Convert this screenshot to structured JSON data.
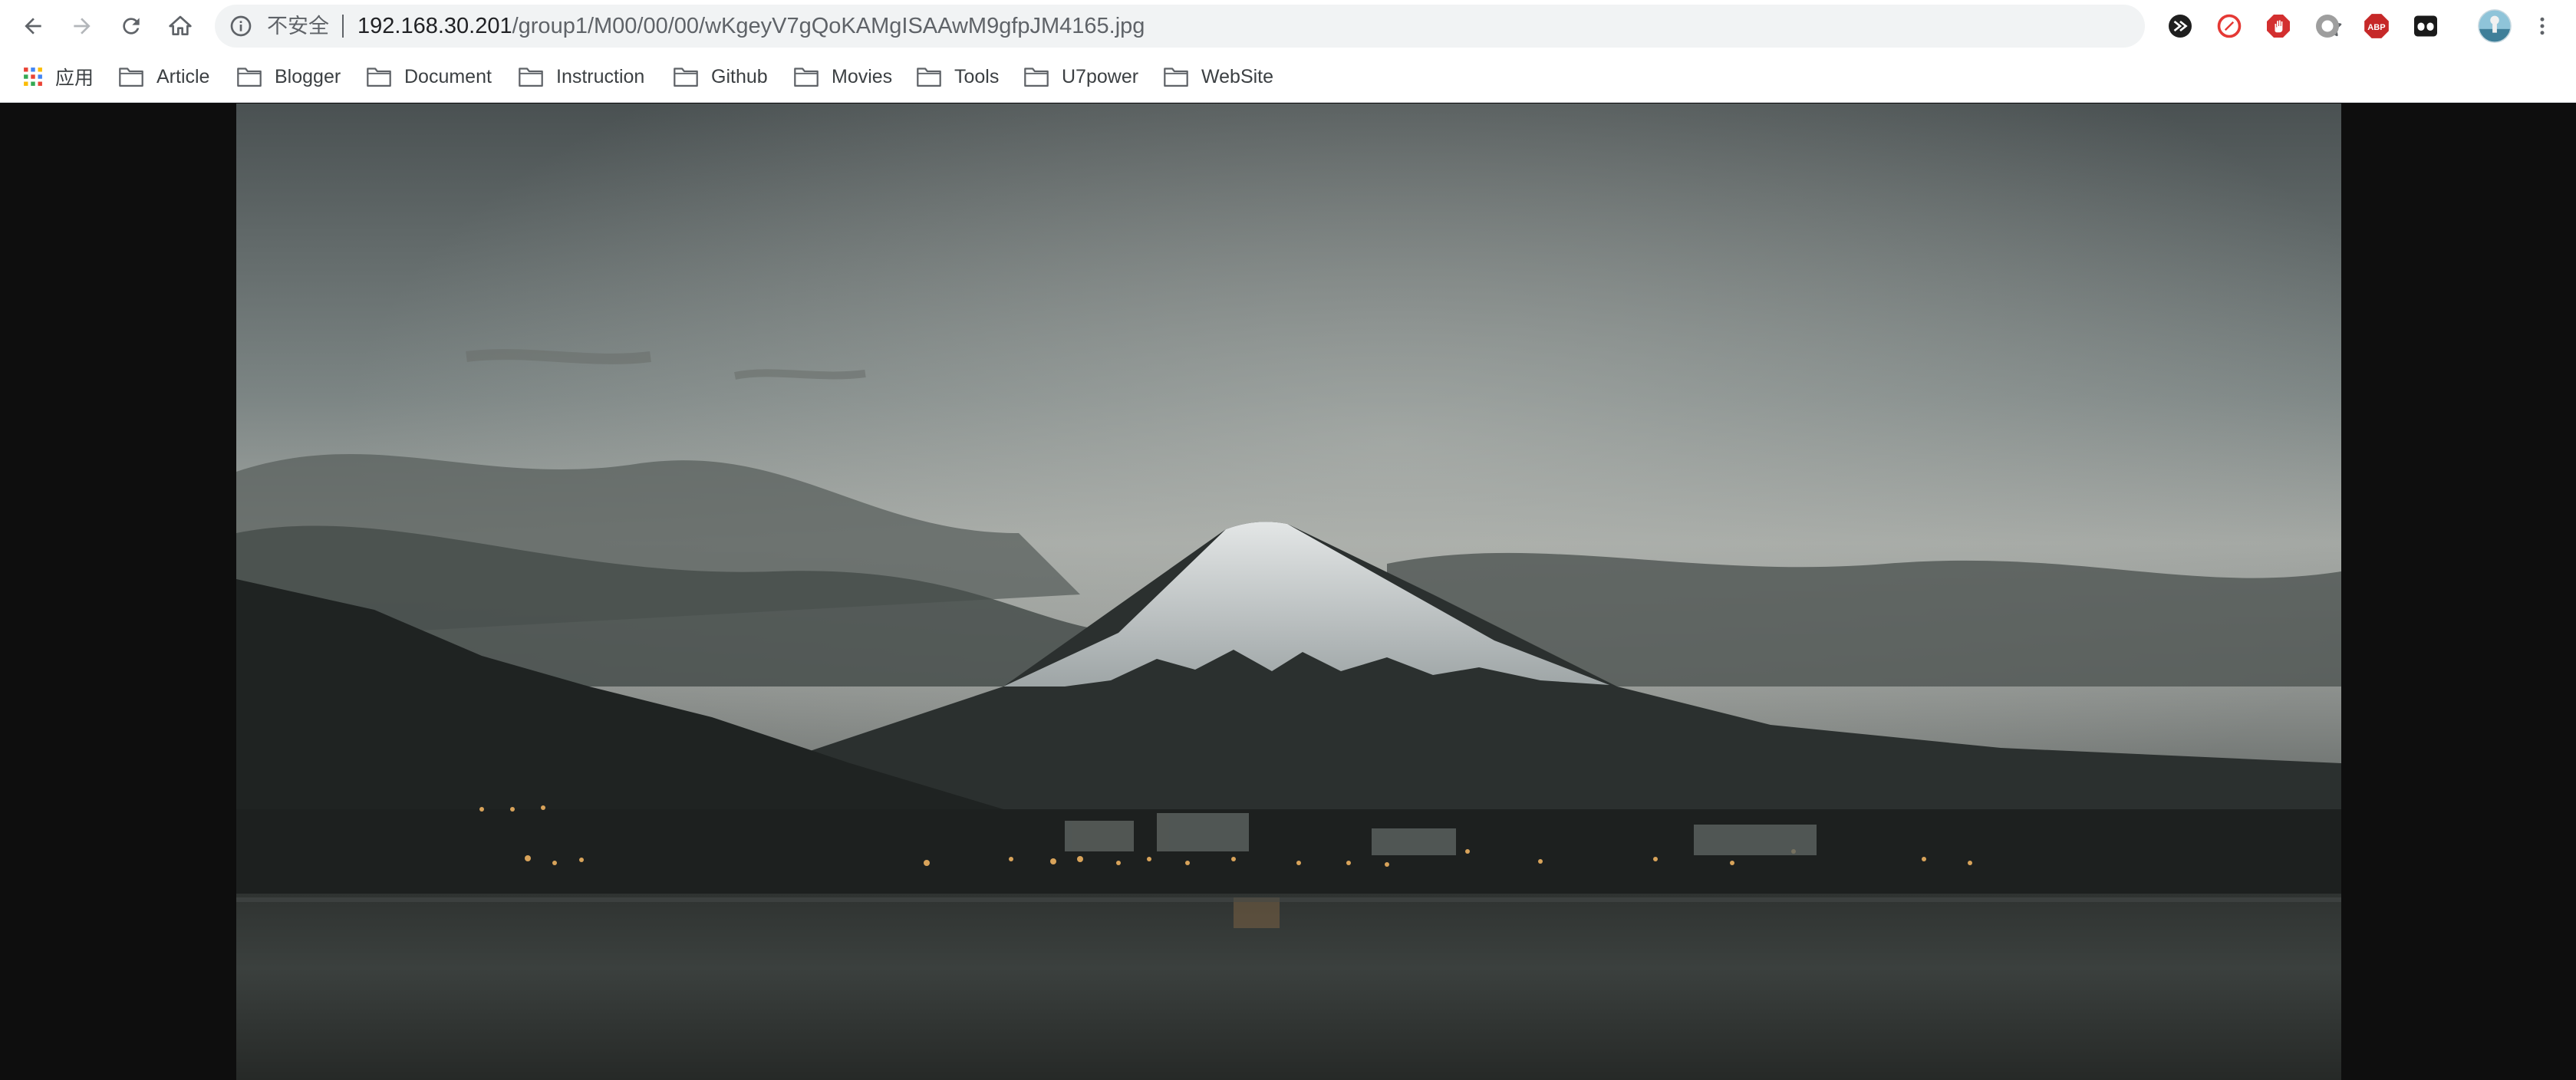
{
  "toolbar": {
    "back_icon": "arrow-left-icon",
    "forward_icon": "arrow-right-icon",
    "reload_icon": "reload-icon",
    "home_icon": "home-icon"
  },
  "omnibox": {
    "security_label": "不安全",
    "url_host": "192.168.30.201",
    "url_path": "/group1/M00/00/00/wKgeyV7gQoKAMgISAAwM9gfpJM4165.jpg",
    "info_icon": "info-icon",
    "bookmark_icon": "star-icon"
  },
  "extensions": [
    {
      "icon": "shield-extension-icon"
    },
    {
      "icon": "red-compass-extension-icon"
    },
    {
      "icon": "red-hand-extension-icon"
    },
    {
      "icon": "gray-circle-extension-icon"
    },
    {
      "label": "ABP",
      "icon": "adblock-plus-icon"
    },
    {
      "icon": "black-mask-extension-icon"
    },
    {
      "icon": "user-avatar"
    },
    {
      "icon": "more-vertical-icon"
    }
  ],
  "bookmarks": {
    "apps_label": "应用",
    "items": [
      {
        "label": "Article"
      },
      {
        "label": "Blogger"
      },
      {
        "label": "Document"
      },
      {
        "label": "Instruction"
      },
      {
        "label": "Github"
      },
      {
        "label": "Movies"
      },
      {
        "label": "Tools"
      },
      {
        "label": "U7power"
      },
      {
        "label": "WebSite"
      }
    ]
  },
  "colors": {
    "viewer_background": "#0e0e0e",
    "toolbar_background": "#ffffff",
    "omnibox_background": "#f1f3f4"
  }
}
